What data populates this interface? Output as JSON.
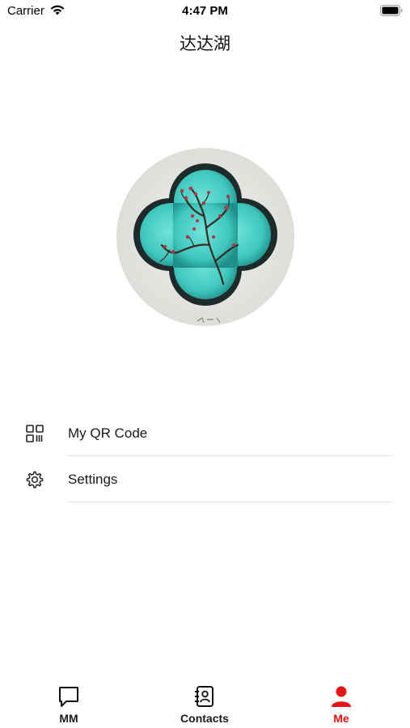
{
  "status_bar": {
    "carrier": "Carrier",
    "time": "4:47 PM",
    "icons": [
      "wifi-icon",
      "battery-icon"
    ]
  },
  "header": {
    "title": "达达湖"
  },
  "profile": {
    "avatar": "avatar-image"
  },
  "menu": {
    "items": [
      {
        "label": "My QR Code",
        "icon": "qr-code-icon"
      },
      {
        "label": "Settings",
        "icon": "gear-icon"
      }
    ]
  },
  "tab_bar": {
    "active_color": "#e81313",
    "tabs": [
      {
        "label": "MM",
        "icon": "chat-bubble-icon",
        "active": false
      },
      {
        "label": "Contacts",
        "icon": "contacts-book-icon",
        "active": false
      },
      {
        "label": "Me",
        "icon": "person-icon",
        "active": true
      }
    ]
  }
}
